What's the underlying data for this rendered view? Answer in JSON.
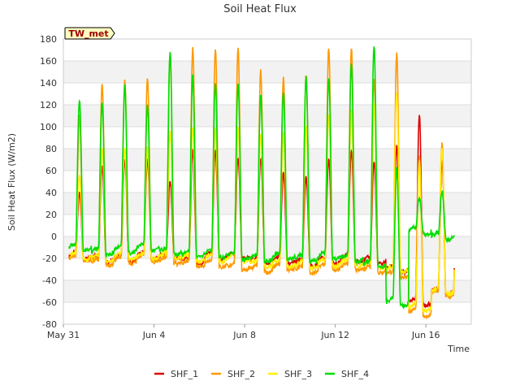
{
  "chart_data": {
    "type": "line",
    "title": "Soil Heat Flux",
    "xlabel": "Time",
    "ylabel": "Soil Heat Flux (W/m2)",
    "annotation": "TW_met",
    "ylim": [
      -80,
      180
    ],
    "yticks": [
      -80,
      -60,
      -40,
      -20,
      0,
      20,
      40,
      60,
      80,
      100,
      120,
      140,
      160,
      180
    ],
    "xlim_days": [
      0,
      18
    ],
    "xticks": [
      {
        "day": 0,
        "label": "May 31"
      },
      {
        "day": 4,
        "label": "Jun 4"
      },
      {
        "day": 8,
        "label": "Jun 8"
      },
      {
        "day": 12,
        "label": "Jun 12"
      },
      {
        "day": 16,
        "label": "Jun 16"
      }
    ],
    "grid": true,
    "legend_position": "bottom",
    "days": [
      0,
      1,
      2,
      3,
      4,
      5,
      6,
      7,
      8,
      9,
      10,
      11,
      12,
      13,
      14,
      15,
      16,
      17
    ],
    "series": [
      {
        "name": "SHF_1",
        "color": "#dd0000",
        "day_peak": [
          40,
          65,
          70,
          70,
          50,
          78,
          78,
          72,
          72,
          58,
          55,
          70,
          78,
          68,
          82,
          110,
          70,
          60
        ],
        "night_min": [
          -18,
          -20,
          -20,
          -18,
          -18,
          -22,
          -18,
          -18,
          -22,
          -22,
          -24,
          -22,
          -20,
          -22,
          -30,
          -60,
          -50,
          -28
        ]
      },
      {
        "name": "SHF_2",
        "color": "#ff9900",
        "day_peak": [
          110,
          139,
          143,
          144,
          165,
          172,
          172,
          172,
          152,
          145,
          148,
          173,
          172,
          145,
          167,
          72,
          85,
          85
        ],
        "night_min": [
          -20,
          -24,
          -22,
          -20,
          -22,
          -25,
          -25,
          -28,
          -30,
          -28,
          -30,
          -28,
          -28,
          -30,
          -35,
          -70,
          -52,
          -32
        ]
      },
      {
        "name": "SHF_3",
        "color": "#ffee00",
        "day_peak": [
          55,
          80,
          80,
          80,
          95,
          100,
          100,
          100,
          95,
          95,
          100,
          110,
          115,
          120,
          130,
          70,
          80,
          70
        ],
        "night_min": [
          -18,
          -20,
          -18,
          -18,
          -18,
          -20,
          -20,
          -20,
          -25,
          -25,
          -26,
          -24,
          -24,
          -26,
          -30,
          -65,
          -50,
          -30
        ]
      },
      {
        "name": "SHF_4",
        "color": "#00dd00",
        "day_peak": [
          124,
          122,
          137,
          120,
          169,
          146,
          140,
          140,
          130,
          132,
          146,
          145,
          158,
          175,
          62,
          35,
          42,
          5
        ],
        "night_min": [
          -10,
          -14,
          -12,
          -10,
          -14,
          -16,
          -16,
          -18,
          -20,
          -18,
          -20,
          -18,
          -20,
          -25,
          -60,
          5,
          0,
          3
        ]
      }
    ]
  }
}
